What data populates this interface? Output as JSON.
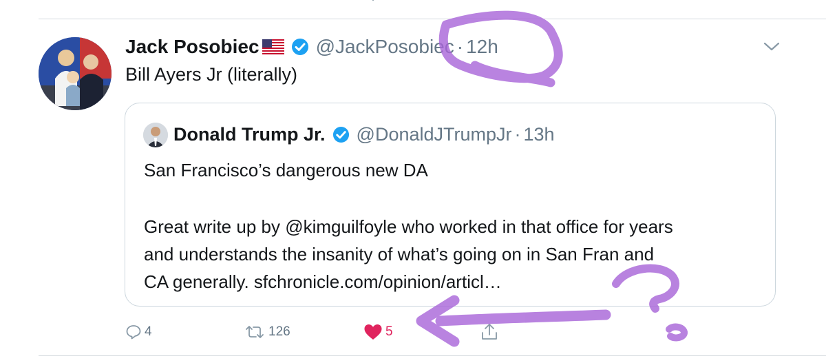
{
  "tweet": {
    "author": {
      "display_name": "Jack Posobiec",
      "flag": "🇺🇸",
      "handle": "@JackPosobiec",
      "separator": "·",
      "time": "12h",
      "verified_icon": "verified-badge-icon",
      "avatar_icon": "profile-photo"
    },
    "text": "Bill Ayers Jr (literally)",
    "menu_icon": "chevron-down-icon",
    "quoted": {
      "display_name": "Donald Trump Jr.",
      "handle": "@DonaldJTrumpJr",
      "separator": "·",
      "time": "13h",
      "lines": [
        "San Francisco’s dangerous new DA",
        "Great write up by @kimguilfoyle who worked in that office for years",
        "and understands the insanity of what’s going on in San Fran and",
        "CA generally.  sfchronicle.com/opinion/articl…"
      ]
    },
    "actions": {
      "reply": {
        "icon": "reply-icon",
        "count": "4"
      },
      "retweet": {
        "icon": "retweet-icon",
        "count": "126"
      },
      "like": {
        "icon": "heart-icon",
        "count": "5",
        "liked": true
      },
      "share": {
        "icon": "share-icon"
      }
    }
  },
  "annotations": {
    "color": "#a764d8",
    "marks": [
      "circle-around-time",
      "arrow-pointing-left",
      "question-mark"
    ]
  },
  "colors": {
    "text_primary": "#14171a",
    "text_secondary": "#657786",
    "verified_blue": "#1da1f2",
    "like_red": "#e0245e",
    "border": "#ccd6dd"
  }
}
